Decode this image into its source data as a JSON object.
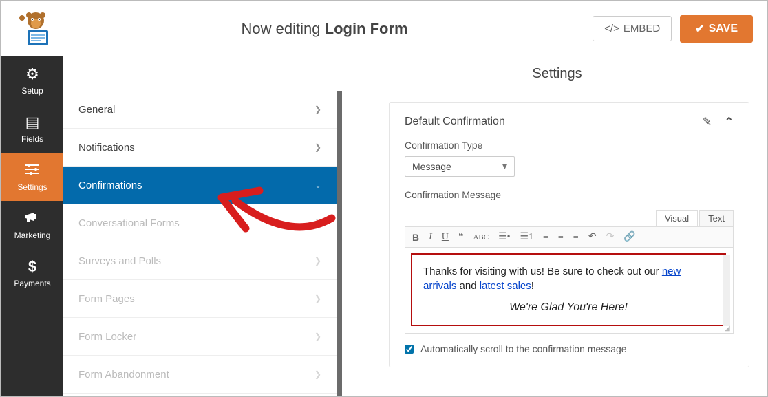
{
  "header": {
    "editing_prefix": "Now editing ",
    "form_name": "Login Form",
    "embed_label": "EMBED",
    "save_label": "SAVE"
  },
  "rail": {
    "items": [
      {
        "label": "Setup",
        "icon": "⚙"
      },
      {
        "label": "Fields",
        "icon": "▤"
      },
      {
        "label": "Settings",
        "icon": "⚙≡"
      },
      {
        "label": "Marketing",
        "icon": "📣"
      },
      {
        "label": "Payments",
        "icon": "$"
      }
    ],
    "active_index": 2
  },
  "submenu": {
    "items": [
      {
        "label": "General",
        "disabled": false
      },
      {
        "label": "Notifications",
        "disabled": false
      },
      {
        "label": "Confirmations",
        "disabled": false
      },
      {
        "label": "Conversational Forms",
        "disabled": true
      },
      {
        "label": "Surveys and Polls",
        "disabled": true
      },
      {
        "label": "Form Pages",
        "disabled": true
      },
      {
        "label": "Form Locker",
        "disabled": true
      },
      {
        "label": "Form Abandonment",
        "disabled": true
      }
    ],
    "active_index": 2
  },
  "main": {
    "heading": "Settings",
    "panel_title": "Default Confirmation",
    "type_label": "Confirmation Type",
    "type_value": "Message",
    "message_label": "Confirmation Message",
    "tabs": {
      "visual": "Visual",
      "text": "Text"
    },
    "message_plain": "Thanks for visiting with us! Be sure to check out our ",
    "link1": "new arrivals",
    "mid": " and",
    "link2": " latest sales",
    "excl": "!",
    "signoff": "We're Glad You're Here!",
    "auto_scroll_label": "Automatically scroll to the confirmation message",
    "auto_scroll_checked": true
  }
}
